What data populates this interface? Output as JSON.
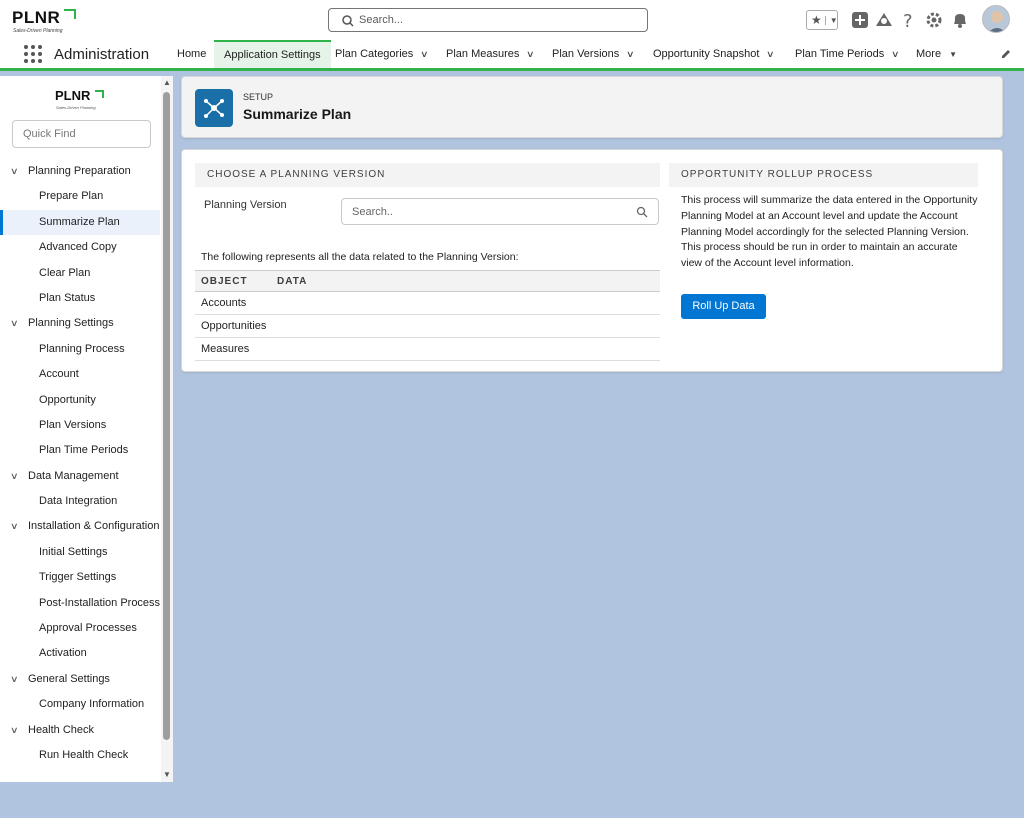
{
  "brand": {
    "name": "PLNR",
    "tagline": "Sales-Driven Planning"
  },
  "header": {
    "search_placeholder": "Search..."
  },
  "nav": {
    "app_name": "Administration",
    "items": [
      {
        "label": "Home"
      },
      {
        "label": "Application Settings"
      },
      {
        "label": "Plan Categories"
      },
      {
        "label": "Plan Measures"
      },
      {
        "label": "Plan Versions"
      },
      {
        "label": "Opportunity Snapshot"
      },
      {
        "label": "Plan Time Periods"
      },
      {
        "label": "More"
      }
    ]
  },
  "sidebar": {
    "quick_find_placeholder": "Quick Find",
    "tree": [
      {
        "label": "Planning Preparation",
        "type": "group"
      },
      {
        "label": "Prepare Plan",
        "type": "leaf"
      },
      {
        "label": "Summarize Plan",
        "type": "leaf",
        "selected": true
      },
      {
        "label": "Advanced Copy",
        "type": "leaf"
      },
      {
        "label": "Clear Plan",
        "type": "leaf"
      },
      {
        "label": "Plan Status",
        "type": "leaf"
      },
      {
        "label": "Planning Settings",
        "type": "group"
      },
      {
        "label": "Planning Process",
        "type": "leaf"
      },
      {
        "label": "Account",
        "type": "leaf"
      },
      {
        "label": "Opportunity",
        "type": "leaf"
      },
      {
        "label": "Plan Versions",
        "type": "leaf"
      },
      {
        "label": "Plan Time Periods",
        "type": "leaf"
      },
      {
        "label": "Data Management",
        "type": "group"
      },
      {
        "label": "Data Integration",
        "type": "leaf"
      },
      {
        "label": "Installation & Configuration",
        "type": "group"
      },
      {
        "label": "Initial Settings",
        "type": "leaf"
      },
      {
        "label": "Trigger Settings",
        "type": "leaf"
      },
      {
        "label": "Post-Installation Process",
        "type": "leaf"
      },
      {
        "label": "Approval Processes",
        "type": "leaf"
      },
      {
        "label": "Activation",
        "type": "leaf"
      },
      {
        "label": "General Settings",
        "type": "group"
      },
      {
        "label": "Company Information",
        "type": "leaf"
      },
      {
        "label": "Health Check",
        "type": "group"
      },
      {
        "label": "Run Health Check",
        "type": "leaf"
      }
    ]
  },
  "page_header": {
    "eyebrow": "SETUP",
    "title": "Summarize Plan"
  },
  "planning_version": {
    "section_title": "CHOOSE A PLANNING VERSION",
    "field_label": "Planning Version",
    "search_placeholder": "Search..",
    "info_text": "The following represents all the data related to the Planning Version:",
    "table": {
      "columns": [
        "OBJECT",
        "DATA"
      ],
      "rows": [
        "Accounts",
        "Opportunities",
        "Measures"
      ]
    }
  },
  "rollup": {
    "section_title": "OPPORTUNITY ROLLUP PROCESS",
    "description": "This process will summarize the data entered in the Opportunity Planning Model at an Account level and update the Account Planning Model accordingly for the selected Planning Version. This process should be run in order to maintain an accurate view of the Account level information.",
    "button_label": "Roll Up Data"
  },
  "colors": {
    "brand_green": "#2fb34a",
    "primary_blue": "#0176d3",
    "page_bg": "#b0c4df",
    "setup_icon": "#1b6fa8"
  }
}
